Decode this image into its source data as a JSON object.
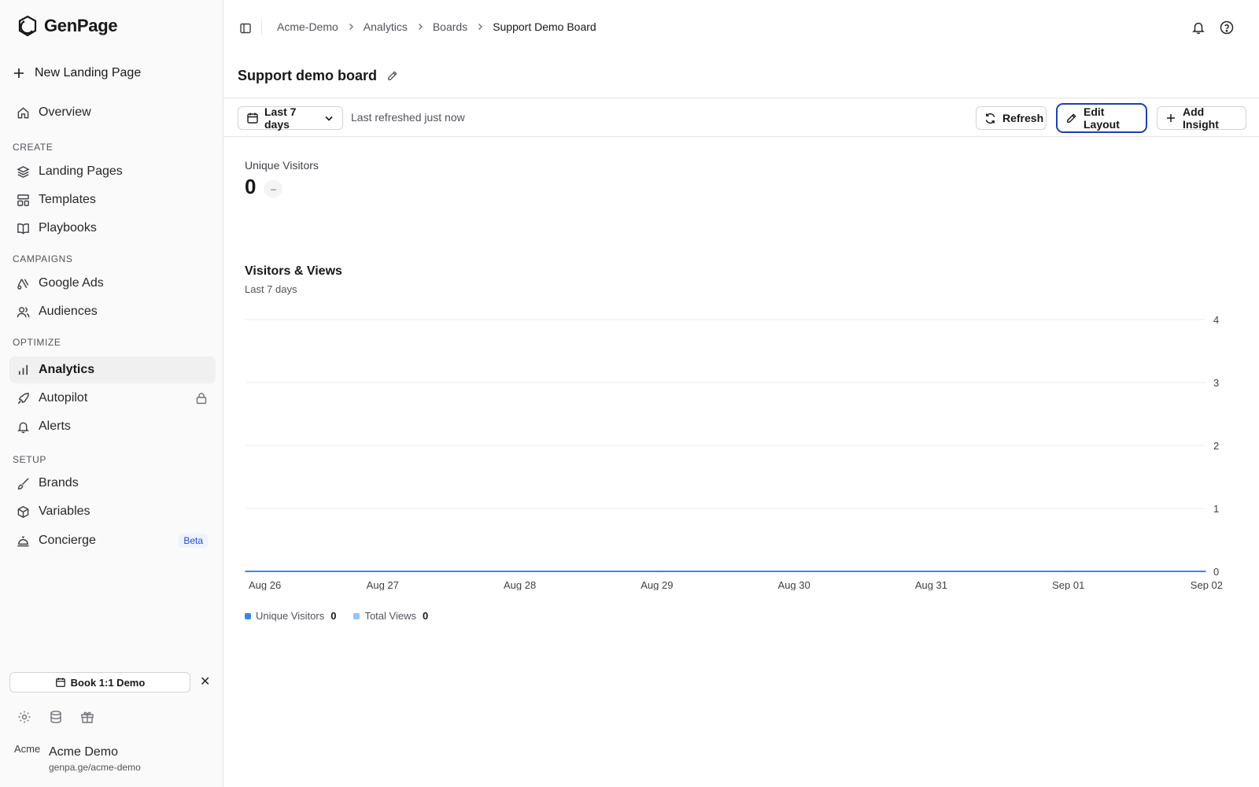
{
  "app": {
    "name": "GenPage"
  },
  "sidebar": {
    "new_page": "New Landing Page",
    "overview": "Overview",
    "sections": {
      "create": "CREATE",
      "campaigns": "CAMPAIGNS",
      "optimize": "OPTIMIZE",
      "setup": "SETUP"
    },
    "items": {
      "landing_pages": "Landing Pages",
      "templates": "Templates",
      "playbooks": "Playbooks",
      "google_ads": "Google Ads",
      "audiences": "Audiences",
      "analytics": "Analytics",
      "autopilot": "Autopilot",
      "alerts": "Alerts",
      "brands": "Brands",
      "variables": "Variables",
      "concierge": "Concierge"
    },
    "active_item": "Analytics",
    "beta_badge": "Beta",
    "demo_button": "Book 1:1 Demo",
    "user": {
      "name": "Acme Demo",
      "url": "genpa.ge/acme-demo",
      "avatar_alt": "Acme"
    }
  },
  "breadcrumb": [
    "Acme-Demo",
    "Analytics",
    "Boards",
    "Support Demo Board"
  ],
  "page": {
    "title": "Support demo board"
  },
  "toolbar": {
    "range": "Last 7 days",
    "refreshed": "Last refreshed just now",
    "refresh": "Refresh",
    "edit_layout": "Edit Layout",
    "add_insight": "Add Insight"
  },
  "metric": {
    "label": "Unique Visitors",
    "value": "0",
    "delta": "–"
  },
  "chart_panel": {
    "title": "Visitors & Views",
    "subtitle": "Last 7 days"
  },
  "chart_data": {
    "type": "line",
    "x": [
      "Aug 26",
      "Aug 27",
      "Aug 28",
      "Aug 29",
      "Aug 30",
      "Aug 31",
      "Sep 01",
      "Sep 02"
    ],
    "y_ticks": [
      0,
      1,
      2,
      3,
      4
    ],
    "ylim": [
      0,
      4
    ],
    "grid": true,
    "legend": "bottom-left",
    "series": [
      {
        "name": "Unique Visitors",
        "values": [
          0,
          0,
          0,
          0,
          0,
          0,
          0,
          0
        ],
        "total": "0",
        "color": "#3b82f6"
      },
      {
        "name": "Total Views",
        "values": [
          0,
          0,
          0,
          0,
          0,
          0,
          0,
          0
        ],
        "total": "0",
        "color": "#93c5fd"
      }
    ]
  },
  "colors": {
    "accent": "#1e40af",
    "sidebar_bg": "#fafafa",
    "active_bg": "#f0f0f1"
  }
}
